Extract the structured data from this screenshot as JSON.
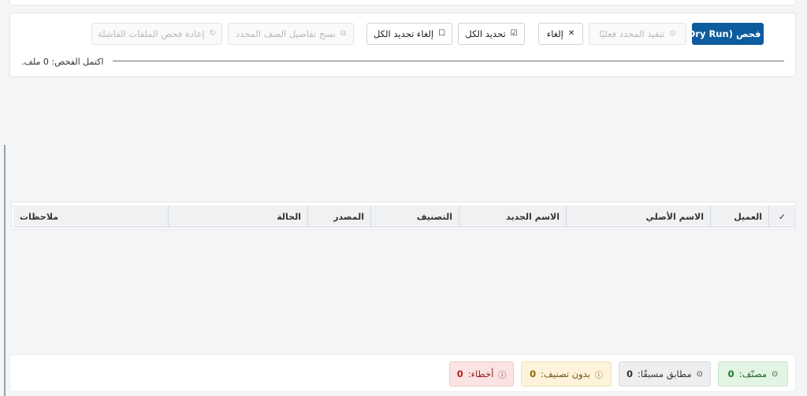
{
  "toolbar": {
    "scan_label": "فحص (Dry Run)",
    "execute_label": "تنفيذ المحدد فعليًا",
    "cancel_label": "إلغاء",
    "select_all_label": "تحديد الكل",
    "deselect_all_label": "إلغاء تحديد الكل",
    "copy_details_label": "نسخ تفاصيل الصف المحدد",
    "rescan_failed_label": "إعادة فحص الملفات الفاشلة"
  },
  "progress": {
    "status_text": "اكتمل الفحص: 0 ملف."
  },
  "table": {
    "columns": [
      {
        "key": "check",
        "label": "✓"
      },
      {
        "key": "client",
        "label": "العميل"
      },
      {
        "key": "original_name",
        "label": "الاسم الأصلي"
      },
      {
        "key": "new_name",
        "label": "الاسم الجديد"
      },
      {
        "key": "classification",
        "label": "التصنيف"
      },
      {
        "key": "source",
        "label": "المصدر"
      },
      {
        "key": "status",
        "label": "الحالة"
      },
      {
        "key": "notes",
        "label": "ملاحظات"
      }
    ],
    "rows": []
  },
  "stats": {
    "classified": {
      "label": "مصنّف:",
      "count": "0",
      "color": "#1f7a2e"
    },
    "matched": {
      "label": "مطابق مسبقًا:",
      "count": "0",
      "color": "#333333"
    },
    "unclassified": {
      "label": "بدون تصنيف:",
      "count": "0",
      "color": "#8a6500"
    },
    "errors": {
      "label": "أخطاء:",
      "count": "0",
      "color": "#b42318"
    }
  },
  "colors": {
    "primary": "#0d5c9e"
  }
}
